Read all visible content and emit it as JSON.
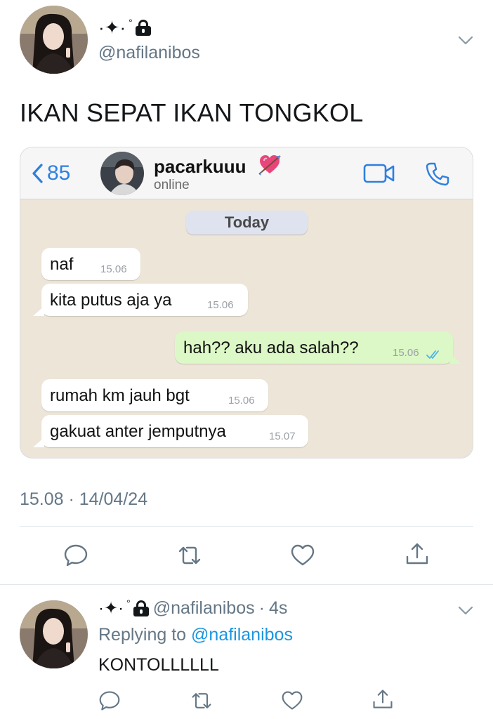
{
  "tweet": {
    "display_name_glyphs": "·✦·",
    "display_name_ring": "°",
    "handle": "@nafilanibos",
    "text": "IKAN SEPAT IKAN TONGKOL",
    "timestamp": "15.08 · 14/04/24"
  },
  "chat": {
    "back_count": "85",
    "contact_name": "pacarkuuu",
    "contact_status": "online",
    "date_chip": "Today",
    "messages": [
      {
        "text": "naf",
        "time": "15.06",
        "direction": "in"
      },
      {
        "text": "kita putus aja ya",
        "time": "15.06",
        "direction": "in"
      },
      {
        "text": "hah?? aku ada salah??",
        "time": "15.06",
        "direction": "out",
        "read": true
      },
      {
        "text": "rumah km jauh bgt",
        "time": "15.06",
        "direction": "in"
      },
      {
        "text": "gakuat anter jemputnya",
        "time": "15.07",
        "direction": "in"
      }
    ],
    "colors": {
      "accent": "#2e7fe0",
      "wallpaper": "#ece5d8",
      "outgoing": "#dcf8c6",
      "incoming": "#ffffff"
    }
  },
  "actions": [
    "reply-icon",
    "retweet-icon",
    "like-icon",
    "share-icon"
  ],
  "reply": {
    "display_name_glyphs": "·✦·",
    "display_name_ring": "°",
    "handle": "@nafilanibos",
    "age": "4s",
    "replying_prefix": "Replying to",
    "replying_to": "@nafilanibos",
    "text": "KONTOLLLLLL"
  },
  "colors": {
    "muted": "#657786",
    "link": "#1b95e0",
    "text": "#14171a"
  }
}
